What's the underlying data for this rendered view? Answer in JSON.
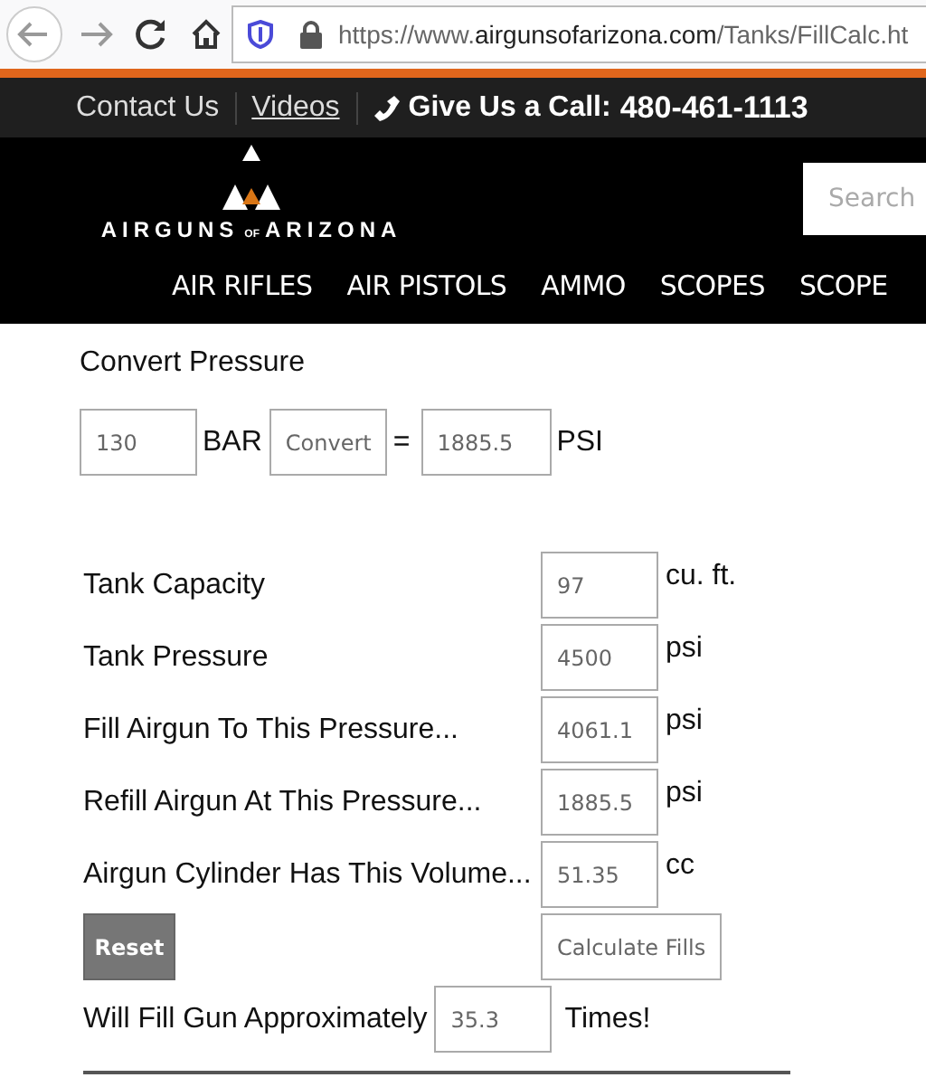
{
  "browser": {
    "url": {
      "prefix": "https://www.",
      "domain": "airgunsofarizona.com",
      "path": "/Tanks/FillCalc.ht"
    }
  },
  "top_bar": {
    "links": [
      {
        "label": "Contact Us",
        "underlined": false
      },
      {
        "label": "Videos",
        "underlined": true
      }
    ],
    "call_label": "Give Us a Call:",
    "phone": "480-461-1113"
  },
  "header": {
    "logo": {
      "words": [
        "AIRGUNS",
        "OF",
        "ARIZONA"
      ]
    },
    "search": {
      "placeholder": "Search"
    },
    "nav": [
      "AIR RIFLES",
      "AIR PISTOLS",
      "AMMO",
      "SCOPES",
      "SCOPE"
    ]
  },
  "converter": {
    "title": "Convert Pressure",
    "input": "130",
    "from_unit": "BAR",
    "button": "Convert",
    "equals": "=",
    "result": "1885.5",
    "to_unit": "PSI"
  },
  "fill_calc": {
    "rows": [
      {
        "label": "Tank Capacity",
        "value": "97",
        "unit": "cu. ft."
      },
      {
        "label": "Tank Pressure",
        "value": "4500",
        "unit": "psi"
      },
      {
        "label": "Fill Airgun To This Pressure...",
        "value": "4061.1",
        "unit": "psi"
      },
      {
        "label": "Refill Airgun At This Pressure...",
        "value": "1885.5",
        "unit": "psi"
      },
      {
        "label": "Airgun Cylinder Has This Volume...",
        "value": "51.35",
        "unit": "cc"
      }
    ],
    "reset_button": "Reset",
    "calculate_button": "Calculate Fills",
    "result": {
      "label": "Will Fill Gun Approximately",
      "value": "35.3",
      "suffix": "Times!"
    }
  }
}
